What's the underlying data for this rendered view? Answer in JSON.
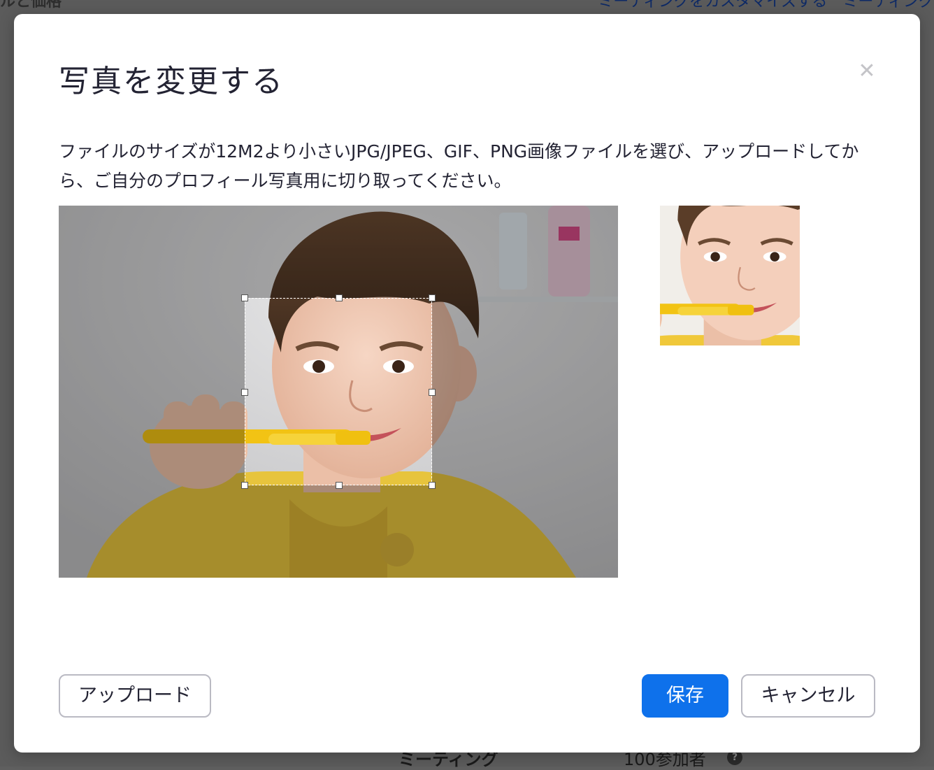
{
  "background": {
    "top_left_text": "ルと価格",
    "top_right_text": "ミーティングをカスタマイズする　ミーティング",
    "bottom_left_text": "ミーティング",
    "bottom_mid_text": "100参加者",
    "help_icon": "question-icon"
  },
  "modal": {
    "title": "写真を変更する",
    "close_icon": "close-icon",
    "description": "ファイルのサイズが12M2より小さいJPG/JPEG、GIF、PNG画像ファイルを選び、アップロードしてから、ご自分のプロフィール写真用に切り取ってください。",
    "buttons": {
      "upload": "アップロード",
      "save": "保存",
      "cancel": "キャンセル"
    }
  },
  "colors": {
    "primary": "#0e71eb",
    "text": "#232333",
    "border": "#babac3"
  }
}
